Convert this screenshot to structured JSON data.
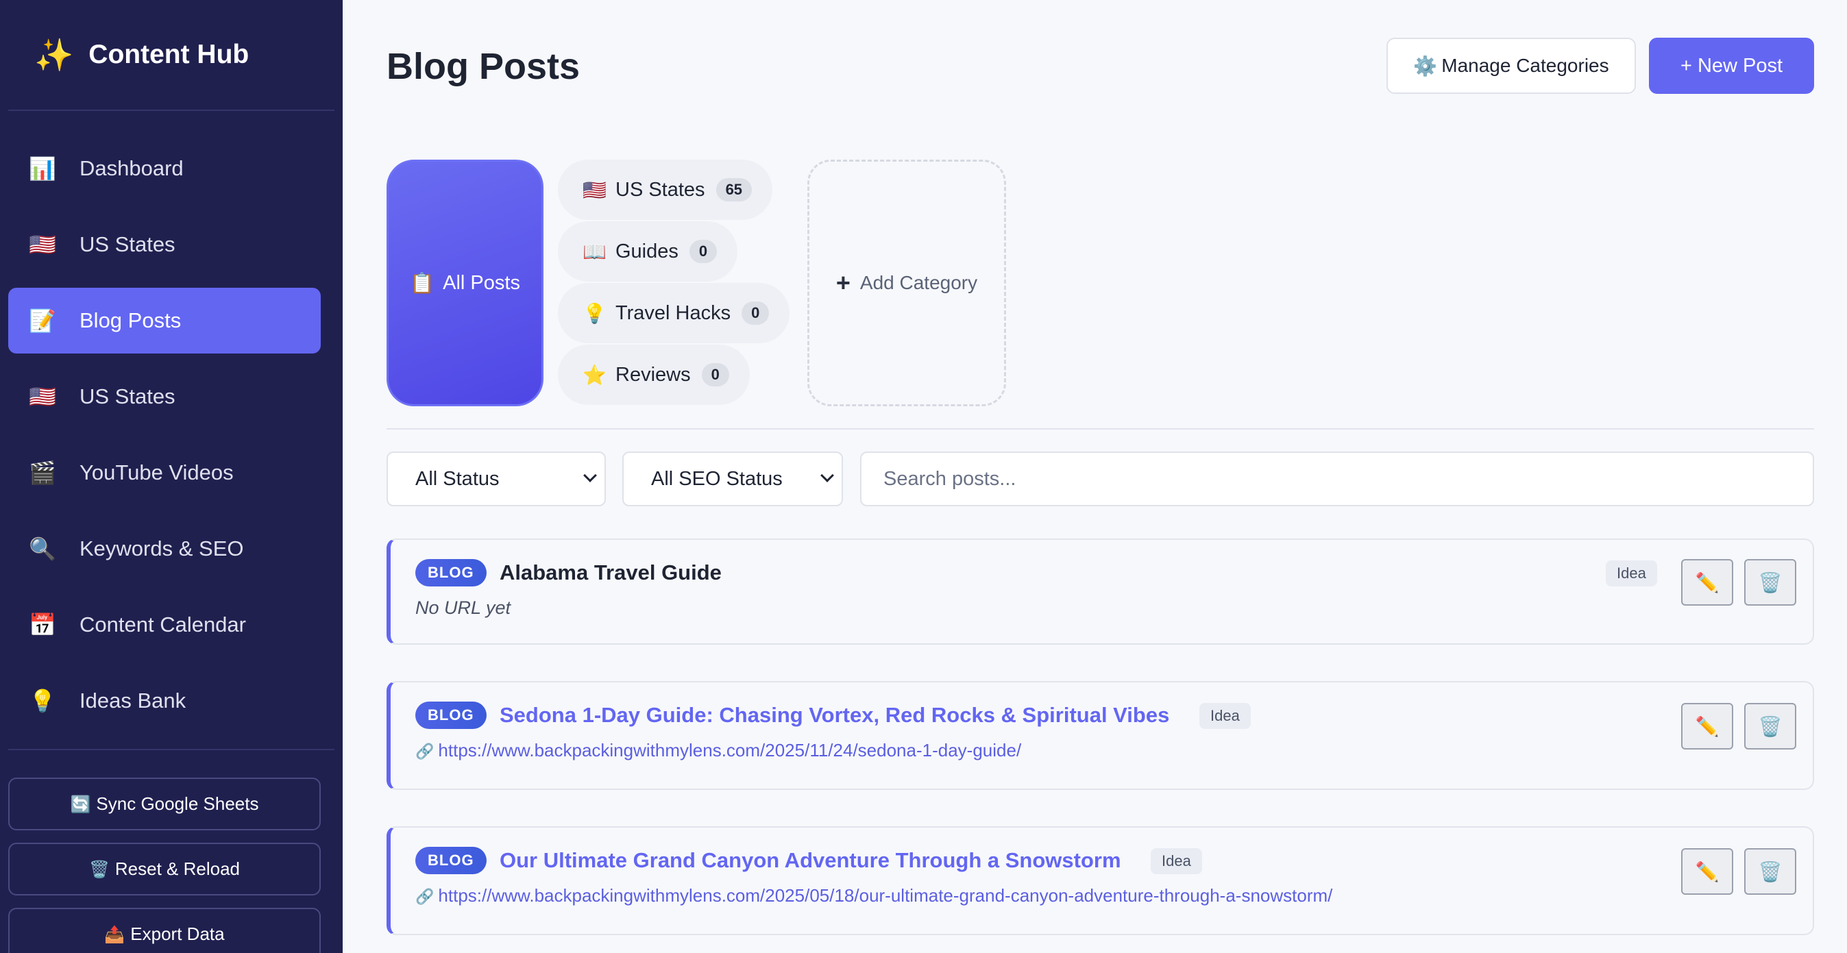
{
  "app": {
    "brand_icon": "✨",
    "brand_name": "Content Hub"
  },
  "sidebar": {
    "items": [
      {
        "icon": "📊",
        "icon_name": "bar-chart-icon",
        "label": "Dashboard"
      },
      {
        "icon": "🇺🇸",
        "icon_name": "us-flag-icon",
        "label": "US States"
      },
      {
        "icon": "📝",
        "icon_name": "memo-icon",
        "label": "Blog Posts",
        "active": true
      },
      {
        "icon": "🇺🇸",
        "icon_name": "us-flag-icon",
        "label": "US States"
      },
      {
        "icon": "🎬",
        "icon_name": "clapper-icon",
        "label": "YouTube Videos"
      },
      {
        "icon": "🔍",
        "icon_name": "magnifier-icon",
        "label": "Keywords & SEO"
      },
      {
        "icon": "📅",
        "icon_name": "calendar-icon",
        "label": "Content Calendar"
      },
      {
        "icon": "💡",
        "icon_name": "lightbulb-icon",
        "label": "Ideas Bank"
      }
    ],
    "actions": [
      {
        "icon": "🔄",
        "label": "Sync Google Sheets"
      },
      {
        "icon": "🗑️",
        "label": "Reset & Reload"
      },
      {
        "icon": "📤",
        "label": "Export Data"
      }
    ]
  },
  "header": {
    "title": "Blog Posts",
    "manage_icon": "⚙️",
    "manage_label": "Manage Categories",
    "new_label": "+ New Post"
  },
  "categories": {
    "all": {
      "icon": "📋",
      "label": "All Posts"
    },
    "items": [
      {
        "icon": "🇺🇸",
        "label": "US States",
        "count": "65"
      },
      {
        "icon": "📖",
        "label": "Guides",
        "count": "0"
      },
      {
        "icon": "💡",
        "label": "Travel Hacks",
        "count": "0"
      },
      {
        "icon": "⭐",
        "label": "Reviews",
        "count": "0"
      }
    ],
    "add": {
      "icon": "+",
      "label": "Add Category"
    }
  },
  "filters": {
    "status": "All Status",
    "seo_status": "All SEO Status",
    "search_placeholder": "Search posts..."
  },
  "posts": [
    {
      "badge": "BLOG",
      "title": "Alabama Travel Guide",
      "status": "Idea",
      "url": "No URL yet"
    },
    {
      "badge": "BLOG",
      "title": "Sedona 1-Day Guide: Chasing Vortex, Red Rocks & Spiritual Vibes",
      "status": "Idea",
      "url_icon": "🔗",
      "url": "https://www.backpackingwithmylens.com/2025/11/24/sedona-1-day-guide/"
    },
    {
      "badge": "BLOG",
      "title": "Our Ultimate Grand Canyon Adventure Through a Snowstorm",
      "status": "Idea",
      "url_icon": "🔗",
      "url": "https://www.backpackingwithmylens.com/2025/05/18/our-ultimate-grand-canyon-adventure-through-a-snowstorm/"
    }
  ],
  "post_actions": {
    "edit_icon": "✏️",
    "delete_icon": "🗑️"
  },
  "colors": {
    "sidebar": "#20204f",
    "accent": "#6366f1",
    "badge": "#4f63e6"
  }
}
